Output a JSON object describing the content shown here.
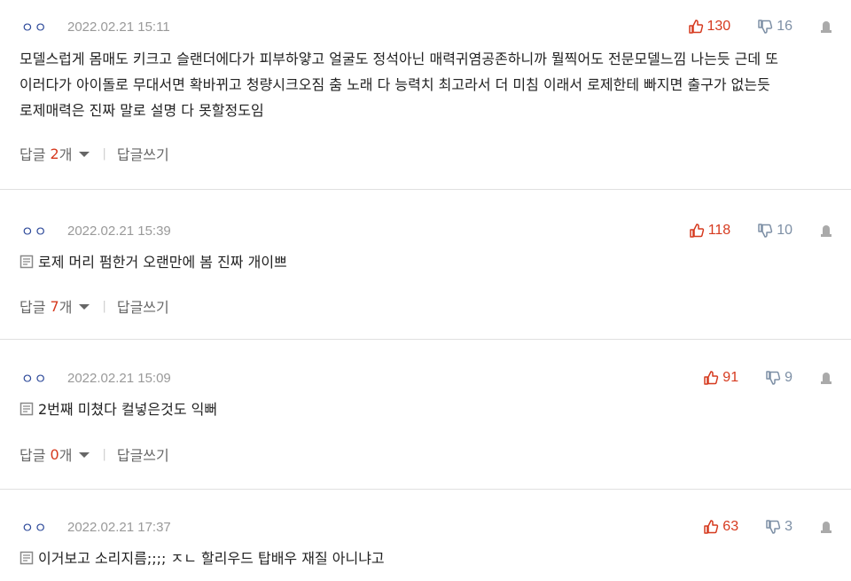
{
  "colors": {
    "nickname": "#2e4a9a",
    "like": "#d63a1f",
    "dislike": "#7d8fa5",
    "reply_count": "#d63a1f",
    "date": "#999999"
  },
  "comments": [
    {
      "nickname": "ㅇㅇ",
      "date": "2022.02.21 15:11",
      "likes": "130",
      "dislikes": "16",
      "body": "모델스럽게 몸매도 키크고 슬랜더에다가 피부하얗고 얼굴도 정석아닌 매력귀염공존하니까 뭘찍어도 전문모델느낌 나는듯 근데 또 이러다가 아이돌로 무대서면 확바뀌고 청량시크오짐 춤 노래 다 능력치 최고라서 더 미침 이래서 로제한테 빠지면 출구가 없는듯 로제매력은 진짜 말로 설명 다 못할정도임",
      "reply_label": "답글",
      "reply_count": "2",
      "reply_unit": "개",
      "write_reply": "답글쓰기"
    },
    {
      "nickname": "ㅇㅇ",
      "date": "2022.02.21 15:39",
      "likes": "118",
      "dislikes": "10",
      "body": "로제 머리 펌한거 오랜만에 봄 진짜 개이쁘",
      "reply_label": "답글",
      "reply_count": "7",
      "reply_unit": "개",
      "write_reply": "답글쓰기"
    },
    {
      "nickname": "ㅇㅇ",
      "date": "2022.02.21 15:09",
      "likes": "91",
      "dislikes": "9",
      "body": "2번째 미쳤다 컬넣은것도 익뻐",
      "reply_label": "답글",
      "reply_count": "0",
      "reply_unit": "개",
      "write_reply": "답글쓰기"
    },
    {
      "nickname": "ㅇㅇ",
      "date": "2022.02.21 17:37",
      "likes": "63",
      "dislikes": "3",
      "body": "이거보고 소리지름;;;; ㅈㄴ 할리우드 탑배우 재질 아니냐고"
    }
  ]
}
